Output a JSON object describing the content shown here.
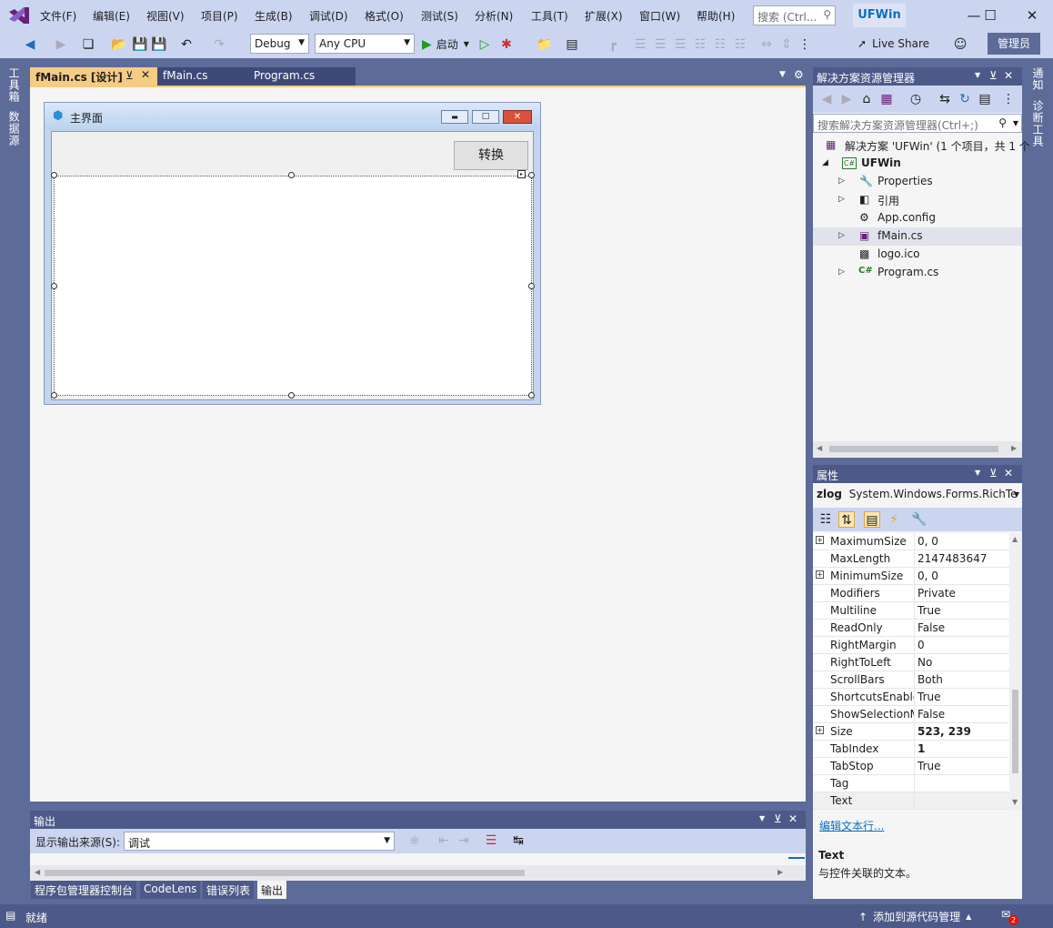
{
  "menu": {
    "items": [
      "文件(F)",
      "编辑(E)",
      "视图(V)",
      "项目(P)",
      "生成(B)",
      "调试(D)",
      "格式(O)",
      "测试(S)",
      "分析(N)",
      "工具(T)",
      "扩展(X)",
      "窗口(W)",
      "帮助(H)"
    ],
    "search_placeholder": "搜索 (Ctrl...",
    "app_name": "UFWin"
  },
  "toolbar": {
    "config": "Debug",
    "platform": "Any CPU",
    "start_label": "启动",
    "live_share": "Live Share",
    "admin": "管理员"
  },
  "side_tabs": {
    "left": [
      "工具箱",
      "数据源"
    ],
    "right": [
      "通知",
      "诊断工具"
    ]
  },
  "doc_tabs": [
    {
      "label": "fMain.cs [设计]",
      "active": true
    },
    {
      "label": "fMain.cs",
      "active": false
    },
    {
      "label": "Program.cs",
      "active": false
    }
  ],
  "designer": {
    "form_title": "主界面",
    "convert_button": "转换"
  },
  "solution_explorer": {
    "title": "解决方案资源管理器",
    "search_placeholder": "搜索解决方案资源管理器(Ctrl+;)",
    "solution_label": "解决方案 'UFWin' (1 个项目，共 1 个",
    "project": "UFWin",
    "items": [
      "Properties",
      "引用",
      "App.config",
      "fMain.cs",
      "logo.ico",
      "Program.cs"
    ]
  },
  "properties": {
    "title": "属性",
    "object_name": "zlog",
    "object_type": "System.Windows.Forms.RichTe",
    "rows": [
      {
        "name": "MaximumSize",
        "value": "0, 0",
        "expandable": true,
        "bold": false
      },
      {
        "name": "MaxLength",
        "value": "2147483647",
        "expandable": false,
        "bold": false
      },
      {
        "name": "MinimumSize",
        "value": "0, 0",
        "expandable": true,
        "bold": false
      },
      {
        "name": "Modifiers",
        "value": "Private",
        "expandable": false,
        "bold": false
      },
      {
        "name": "Multiline",
        "value": "True",
        "expandable": false,
        "bold": false
      },
      {
        "name": "ReadOnly",
        "value": "False",
        "expandable": false,
        "bold": false
      },
      {
        "name": "RightMargin",
        "value": "0",
        "expandable": false,
        "bold": false
      },
      {
        "name": "RightToLeft",
        "value": "No",
        "expandable": false,
        "bold": false
      },
      {
        "name": "ScrollBars",
        "value": "Both",
        "expandable": false,
        "bold": false
      },
      {
        "name": "ShortcutsEnabled",
        "value": "True",
        "expandable": false,
        "bold": false
      },
      {
        "name": "ShowSelectionMargin",
        "value": "False",
        "expandable": false,
        "bold": false
      },
      {
        "name": "Size",
        "value": "523, 239",
        "expandable": true,
        "bold": true
      },
      {
        "name": "TabIndex",
        "value": "1",
        "expandable": false,
        "bold": true
      },
      {
        "name": "TabStop",
        "value": "True",
        "expandable": false,
        "bold": false
      },
      {
        "name": "Tag",
        "value": "",
        "expandable": false,
        "bold": false
      },
      {
        "name": "Text",
        "value": "",
        "expandable": false,
        "bold": false
      }
    ],
    "edit_link": "编辑文本行...",
    "desc_title": "Text",
    "desc_text": "与控件关联的文本。"
  },
  "output": {
    "title": "输出",
    "source_label": "显示输出来源(S):",
    "source_value": "调试"
  },
  "bottom_tabs": [
    "程序包管理器控制台",
    "CodeLens",
    "错误列表",
    "输出"
  ],
  "status": {
    "left": "就绪",
    "source_control": "添加到源代码管理",
    "notifications": "2"
  },
  "colors": {
    "accent": "#0e70c0",
    "chrome": "#5d6b99",
    "toolbar": "#ccd5f0"
  }
}
